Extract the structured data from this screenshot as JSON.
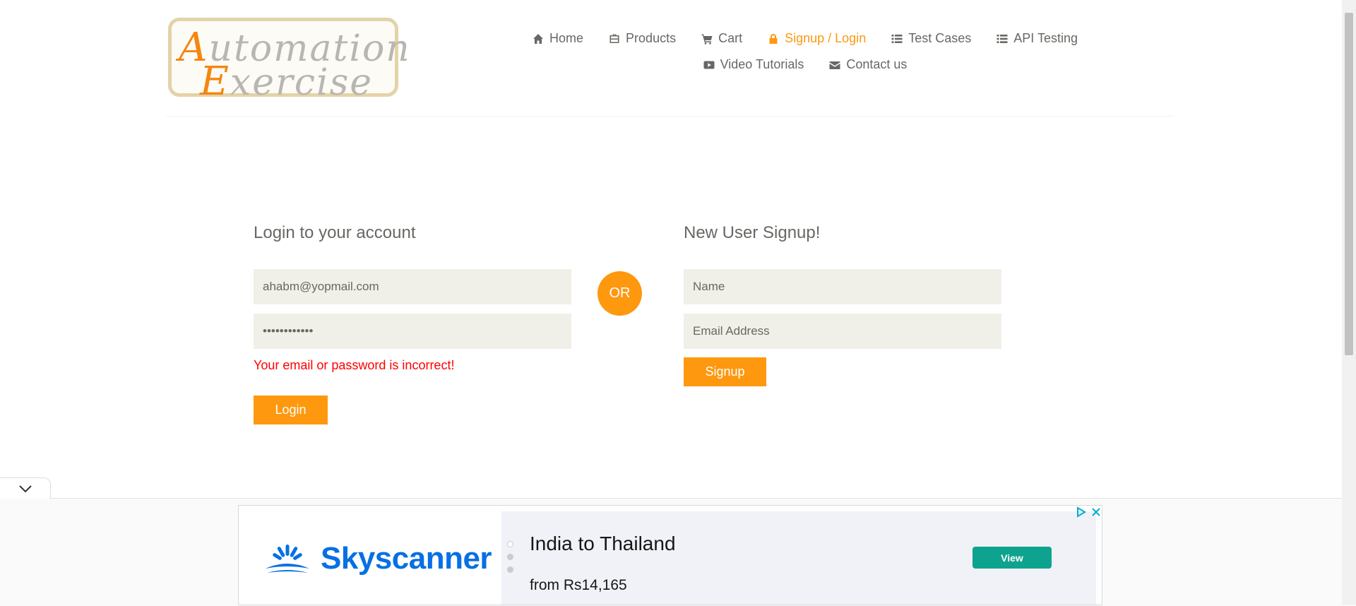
{
  "logo": {
    "line1_cap": "A",
    "line1_rest": "utomation",
    "line2_cap": "E",
    "line2_rest": "xercise"
  },
  "nav": {
    "items": [
      {
        "label": "Home",
        "icon": "home-icon"
      },
      {
        "label": "Products",
        "icon": "briefcase-icon"
      },
      {
        "label": "Cart",
        "icon": "cart-icon"
      },
      {
        "label": "Signup / Login",
        "icon": "lock-icon",
        "active": true
      },
      {
        "label": "Test Cases",
        "icon": "list-icon"
      },
      {
        "label": "API Testing",
        "icon": "list-icon"
      },
      {
        "label": "Video Tutorials",
        "icon": "youtube-icon"
      },
      {
        "label": "Contact us",
        "icon": "envelope-icon"
      }
    ]
  },
  "login": {
    "title": "Login to your account",
    "email_value": "ahabm@yopmail.com",
    "password_value": "••••••••••••",
    "error": "Your email or password is incorrect!",
    "button": "Login"
  },
  "or_label": "OR",
  "signup": {
    "title": "New User Signup!",
    "name_placeholder": "Name",
    "email_placeholder": "Email Address",
    "button": "Signup"
  },
  "ad": {
    "brand": "Skyscanner",
    "headline": "India to Thailand",
    "price": "from Rs14,165",
    "cta": "View"
  },
  "colors": {
    "accent": "#fe980f",
    "error": "#ff0000",
    "ad_brand": "#0770e3",
    "ad_cta": "#0ea38e"
  }
}
